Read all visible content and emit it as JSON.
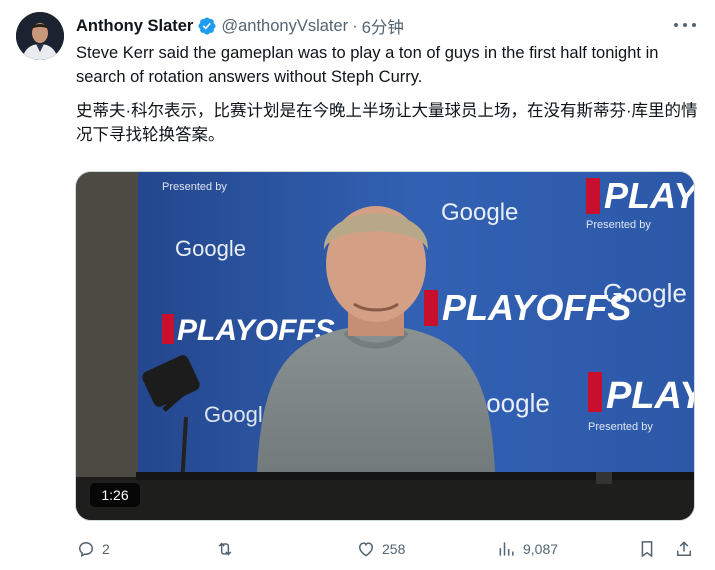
{
  "tweet": {
    "author_name": "Anthony Slater",
    "author_handle": "@anthonyVslater",
    "separator": "·",
    "time": "6分钟",
    "text": "Steve Kerr said the gameplan was to play a ton of guys in the first half tonight in search of rotation answers without Steph Curry.",
    "translation": "史蒂夫·科尔表示，比赛计划是在今晚上半场让大量球员上场，在没有斯蒂芬·库里的情况下寻找轮换答案。"
  },
  "media": {
    "duration": "1:26",
    "backdrop_words": [
      "Google",
      "PLAYOFFS",
      "Presented by"
    ]
  },
  "actions": {
    "replies": "2",
    "reposts": "",
    "likes": "258",
    "views": "9,087"
  },
  "colors": {
    "text": "#0f1419",
    "muted": "#536471",
    "verified": "#1d9bf0",
    "backdrop_blue": "#2c54a6"
  }
}
